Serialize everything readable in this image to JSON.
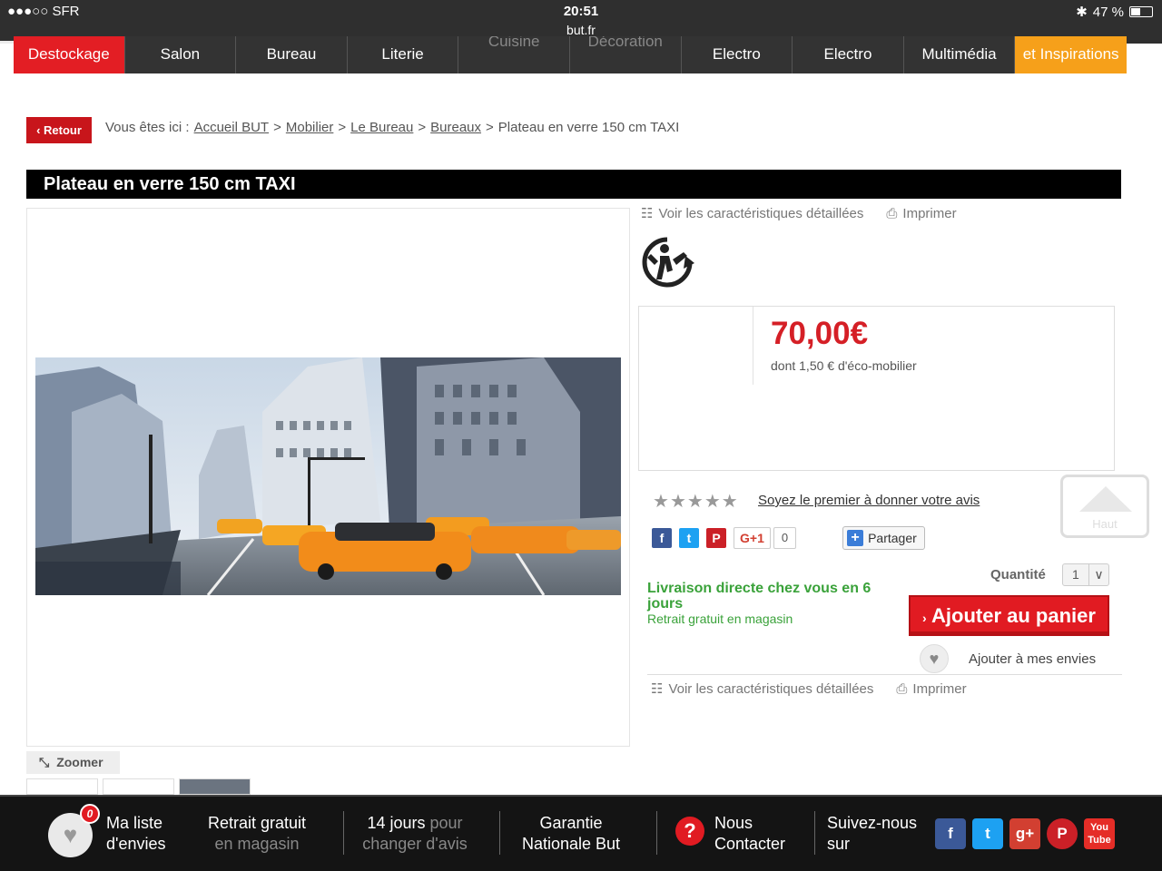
{
  "status_bar": {
    "carrier": "●●●○○ SFR",
    "time": "20:51",
    "url": "but.fr",
    "battery": "47 %",
    "battery_level": 0.47
  },
  "nav": {
    "items": [
      {
        "label": "Destockage",
        "style": "red"
      },
      {
        "label": "Salon",
        "style": "normal"
      },
      {
        "label": "Bureau",
        "style": "normal"
      },
      {
        "label": "Literie",
        "style": "normal"
      },
      {
        "label": "Cuisine",
        "style": "dim"
      },
      {
        "label": "Décoration",
        "style": "dim"
      },
      {
        "label": "Electro",
        "style": "normal"
      },
      {
        "label": "Electro",
        "style": "normal"
      },
      {
        "label": "Multimédia",
        "style": "normal"
      },
      {
        "label": "et Inspirations",
        "style": "orange"
      }
    ]
  },
  "breadcrumb": {
    "retour": "‹ Retour",
    "prefix": "Vous êtes ici :",
    "links": [
      "Accueil BUT",
      "Mobilier",
      "Le Bureau",
      "Bureaux"
    ],
    "separator": ">",
    "current": "Plateau en verre 150 cm TAXI"
  },
  "product": {
    "title": "Plateau en verre 150 cm TAXI",
    "zoom_label": "Zoomer",
    "price": "70,00€",
    "eco_fee": "dont 1,50 € d'éco-mobilier",
    "rating_stars": 5,
    "review_link": "Soyez le premier à donner votre avis",
    "quantity_label": "Quantité",
    "quantity_value": "1",
    "delivery": "Livraison directe chez vous en 6 jours",
    "pickup": "Retrait gratuit en magasin",
    "add_to_cart": "Ajouter au panier",
    "wishlist": "Ajouter à mes envies"
  },
  "tools": {
    "details": "Voir les caractéristiques détaillées",
    "print": "Imprimer"
  },
  "social": {
    "gplus_label": "G+1",
    "gplus_count": "0",
    "share": "Partager"
  },
  "scroll_top": {
    "label": "Haut"
  },
  "footer": {
    "wishlist_count": "0",
    "wishlist_line1": "Ma liste",
    "wishlist_line2": "d'envies",
    "pickup_line1": "Retrait gratuit",
    "pickup_line2": "en magasin",
    "return_line1": "14 jours",
    "return_line1b": "pour",
    "return_line2": "changer d'avis",
    "guarantee_line1": "Garantie",
    "guarantee_line2": "Nationale But",
    "contact_line1": "Nous",
    "contact_line2": "Contacter",
    "follow_line1": "Suivez-nous",
    "follow_line2": "sur"
  },
  "colors": {
    "brand_red": "#e31e24",
    "accent_orange": "#f6a01a",
    "delivery_green": "#3aa23a"
  }
}
